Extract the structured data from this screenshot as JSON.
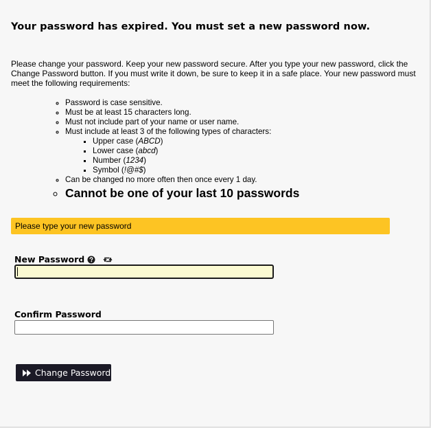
{
  "heading": "Your password has expired. You must set a new password now.",
  "intro": "Please change your password. Keep your new password secure. After you type your new password, click the Change Password button. If you must write it down, be sure to keep it in a safe place. Your new password must meet the following requirements:",
  "requirements": {
    "case_sensitive": "Password is case sensitive.",
    "min_length": "Must be at least 15 characters long.",
    "no_name": "Must not include part of your name or user name.",
    "char_types_intro": "Must include at least 3 of the following types of characters:",
    "char_types": [
      {
        "label": "Upper case (",
        "example": "ABCD",
        "suffix": ")"
      },
      {
        "label": "Lower case (",
        "example": "abcd",
        "suffix": ")"
      },
      {
        "label": "Number (",
        "example": "1234",
        "suffix": ")"
      },
      {
        "label": "Symbol (",
        "example": "!@#$",
        "suffix": ")"
      }
    ],
    "change_frequency": "Can be changed no more often then once every 1 day.",
    "history": "Cannot be one of your last 10 passwords"
  },
  "alert": {
    "text": "Please type your new password",
    "color": "#fdc423"
  },
  "new_password": {
    "label": "New Password",
    "value": "",
    "help_icon": "question-circle-icon",
    "refresh_icon": "retweet-icon"
  },
  "confirm_password": {
    "label": "Confirm Password",
    "value": ""
  },
  "submit": {
    "label": "Change Password",
    "icon": "fast-forward-icon"
  }
}
